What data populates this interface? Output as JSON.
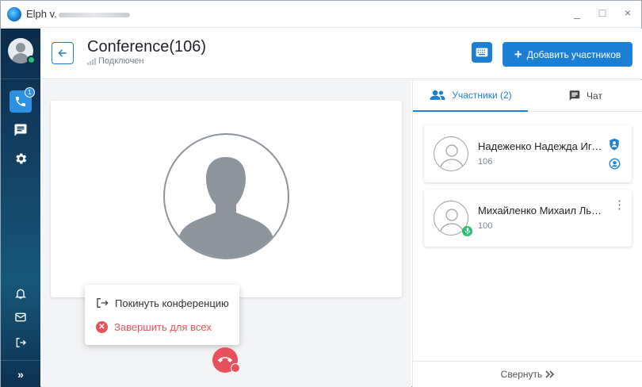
{
  "window": {
    "title": "Elph v.",
    "controls": {
      "minimize": "_",
      "maximize": "□",
      "close": "×"
    }
  },
  "sidebar": {
    "call_badge": "1",
    "expand_label": "»"
  },
  "header": {
    "title": "Conference(106)",
    "status": "Подключен",
    "add_button_label": "Добавить участников"
  },
  "menu": {
    "leave_label": "Покинуть конференцию",
    "end_all_label": "Завершить для всех"
  },
  "panel": {
    "tab_participants": "Участники (2)",
    "tab_chat": "Чат",
    "participants": [
      {
        "name": "Надеженко Надежда Игоревна",
        "ext": "106"
      },
      {
        "name": "Михайленко Михаил Львович",
        "ext": "100"
      }
    ],
    "collapse_label": "Свернуть"
  },
  "colors": {
    "accent": "#1c7fd6",
    "danger": "#e8505b",
    "online": "#2bbf75",
    "sidebar": "#0b2c4a"
  },
  "icons": [
    "app-logo-icon",
    "call-icon",
    "chat-icon",
    "gear-icon",
    "bell-icon",
    "mail-icon",
    "logout-icon",
    "back-arrow-icon",
    "keyboard-icon",
    "plus-icon",
    "participants-icon",
    "chat-tab-icon",
    "shield-icon",
    "person-circle-icon",
    "more-vert-icon",
    "mic-icon",
    "hangup-icon",
    "exit-icon",
    "close-circle-icon"
  ]
}
